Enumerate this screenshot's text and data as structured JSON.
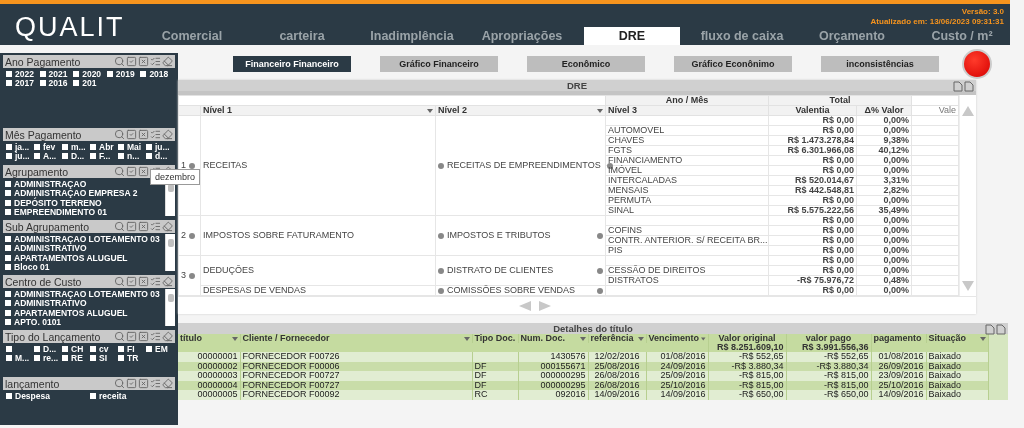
{
  "header": {
    "logo": "QUALIT",
    "version": "Versão: 3.0",
    "updated": "Atualizado em: 13/06/2023 09:31:31",
    "tabs": [
      {
        "label": "Comercial",
        "selected": false
      },
      {
        "label": "carteira",
        "selected": false
      },
      {
        "label": "Inadimplência",
        "selected": false
      },
      {
        "label": "Apropriações",
        "selected": false
      },
      {
        "label": "DRE",
        "selected": true
      },
      {
        "label": "fluxo de caixa",
        "selected": false
      },
      {
        "label": "Orçamento",
        "selected": false
      },
      {
        "label": "Custo / m²",
        "selected": false
      }
    ]
  },
  "filters": [
    {
      "title": "Ano Pagamento",
      "kind": "years",
      "items": [
        {
          "label": "2022",
          "checked": false
        },
        {
          "label": "2021",
          "checked": false
        },
        {
          "label": "2020",
          "checked": false
        },
        {
          "label": "2019",
          "checked": false
        },
        {
          "label": "2018",
          "checked": false
        },
        {
          "label": "2017",
          "checked": false
        },
        {
          "label": "2016",
          "checked": false
        },
        {
          "label": "201",
          "checked": false
        }
      ]
    },
    {
      "title": "Mês Pagamento",
      "kind": "grid",
      "items": [
        {
          "label": "ja...",
          "checked": false
        },
        {
          "label": "fev",
          "checked": false
        },
        {
          "label": "m...",
          "checked": false
        },
        {
          "label": "Abr",
          "checked": false
        },
        {
          "label": "Mai",
          "checked": false
        },
        {
          "label": "ju...",
          "checked": false
        },
        {
          "label": "ju...",
          "checked": false
        },
        {
          "label": "A...",
          "checked": false
        },
        {
          "label": "D...",
          "checked": false
        },
        {
          "label": "F...",
          "checked": false
        },
        {
          "label": "n...",
          "checked": false
        },
        {
          "label": "d...",
          "checked": false
        }
      ]
    },
    {
      "title": "Agrupamento",
      "kind": "list",
      "items": [
        {
          "label": "ADMINISTRAÇAO",
          "checked": false
        },
        {
          "label": "ADMINISTRAÇAO EMPRESA 2",
          "checked": false
        },
        {
          "label": "DEPÓSITO TERRENO",
          "checked": false
        },
        {
          "label": "EMPREENDIMENTO 01",
          "checked": false
        }
      ]
    },
    {
      "title": "Sub Agrupamento",
      "kind": "list",
      "items": [
        {
          "label": "ADMINISTRAÇAO LOTEAMENTO 03",
          "checked": false
        },
        {
          "label": "ADMINISTRATIVO",
          "checked": false
        },
        {
          "label": "APARTAMENTOS ALUGUEL",
          "checked": false
        },
        {
          "label": "Bloco 01",
          "checked": false
        }
      ]
    },
    {
      "title": "Centro de Custo",
      "kind": "list",
      "items": [
        {
          "label": "ADMINISTRAÇAO LOTEAMENTO 03",
          "checked": false
        },
        {
          "label": "ADMINISTRATIVO",
          "checked": false
        },
        {
          "label": "APARTAMENTOS ALUGUEL",
          "checked": false
        },
        {
          "label": "APTO. 0101",
          "checked": false
        }
      ]
    },
    {
      "title": "Tipo do Lançamento",
      "kind": "grid",
      "items": [
        {
          "checked": false
        },
        {
          "label": "D...",
          "checked": false
        },
        {
          "label": "CH",
          "checked": false
        },
        {
          "label": "cv",
          "checked": false
        },
        {
          "label": "FI",
          "checked": false
        },
        {
          "label": "EM",
          "checked": false
        },
        {
          "label": "M...",
          "checked": false
        },
        {
          "label": "re...",
          "checked": false
        },
        {
          "label": "RE",
          "checked": false
        },
        {
          "label": "SI",
          "checked": false
        },
        {
          "label": "TR",
          "checked": false
        }
      ]
    },
    {
      "title": "lançamento",
      "kind": "pair",
      "items": [
        {
          "label": "Despesa",
          "checked": false
        },
        {
          "label": "receita",
          "checked": false
        }
      ]
    }
  ],
  "tooltip": "dezembro",
  "buttons": [
    {
      "label": "Financeiro Financeiro",
      "selected": true
    },
    {
      "label": "Gráfico Financeiro",
      "selected": false
    },
    {
      "label": "Econômico",
      "selected": false
    },
    {
      "label": "Gráfico Econônimo",
      "selected": false
    },
    {
      "label": "inconsistências",
      "selected": false
    }
  ],
  "dre": {
    "title": "DRE",
    "group_header": "Ano / Mês",
    "total_header": "Total",
    "columns": [
      "Nível 1",
      "Nível 2",
      "Nível 3",
      "Valentia",
      "Δ% Valor",
      "Vale"
    ],
    "groups": [
      {
        "number": "1",
        "sections": [
          {
            "level1": "RECEITAS",
            "level2": "RECEITAS DE EMPREENDIMENTOS",
            "rows": [
              {
                "value": "R$ 0,00",
                "pct": "0,00%"
              },
              {
                "level3": "AUTOMOVEL",
                "value": "R$ 0,00",
                "pct": "0,00%"
              },
              {
                "level3": "CHAVES",
                "value": "R$ 1.473.278,84",
                "pct": "9,38%"
              },
              {
                "level3": "FGTS",
                "value": "R$ 6.301.966,08",
                "pct": "40,12%"
              },
              {
                "level3": "FINANCIAMENTO",
                "value": "R$ 0,00",
                "pct": "0,00%"
              },
              {
                "level3": "IMÓVEL",
                "value": "R$ 0,00",
                "pct": "0,00%"
              },
              {
                "level3": "INTERCALADAS",
                "value": "R$ 520.014,67",
                "pct": "3,31%"
              },
              {
                "level3": "MENSAIS",
                "value": "R$ 442.548,81",
                "pct": "2,82%"
              },
              {
                "level3": "PERMUTA",
                "value": "R$ 0,00",
                "pct": "0,00%"
              },
              {
                "level3": "SINAL",
                "value": "R$ 5.575.222,56",
                "pct": "35,49%"
              }
            ]
          }
        ]
      },
      {
        "number": "2",
        "sections": [
          {
            "level1": "IMPOSTOS SOBRE FATURAMENTO",
            "level2": "IMPOSTOS E TRIBUTOS",
            "rows": [
              {
                "value": "R$ 0,00",
                "pct": "0,00%"
              },
              {
                "level3": "COFINS",
                "value": "R$ 0,00",
                "pct": "0,00%"
              },
              {
                "level3": "CONTR. ANTERIOR. S/ RECEITA BR...",
                "value": "R$ 0,00",
                "pct": "0,00%"
              },
              {
                "level3": "PIS",
                "value": "R$ 0,00",
                "pct": "0,00%"
              }
            ]
          }
        ]
      },
      {
        "number": "3",
        "sections": [
          {
            "level1": "DEDUÇÕES",
            "level2": "DISTRATO DE CLIENTES",
            "rows": [
              {
                "value": "R$ 0,00",
                "pct": "0,00%"
              },
              {
                "level3": "CESSÃO DE DIREITOS",
                "value": "R$ 0,00",
                "pct": "0,00%"
              },
              {
                "level3": "DISTRATOS",
                "value": "-R$ 75.976,72",
                "pct": "0,48%"
              }
            ]
          },
          {
            "level1": "DESPESAS DE VENDAS",
            "level2": "COMISSÕES SOBRE VENDAS",
            "rows": [
              {
                "value": "R$ 0,00",
                "pct": "0,00%"
              }
            ]
          }
        ]
      }
    ]
  },
  "details": {
    "title": "Detalhes do título",
    "columns": [
      "título",
      "Cliente / Fornecedor",
      "Tipo Doc.",
      "Num. Doc.",
      "referência",
      "Vencimento",
      "Valor original",
      "valor pago",
      "pagamento",
      "Situação"
    ],
    "totals": {
      "original": "R$ 8.251.609,10",
      "paid": "R$ 3.991.556,36"
    },
    "rows": [
      [
        "00000001",
        "FORNECEDOR F00726",
        "",
        "1430576",
        "12/02/2016",
        "01/08/2016",
        "-R$ 552,65",
        "-R$ 552,65",
        "01/08/2016",
        "Baixado"
      ],
      [
        "00000002",
        "FORNECEDOR F00006",
        "DF",
        "000155671",
        "25/08/2016",
        "24/09/2016",
        "-R$ 3.880,34",
        "-R$ 3.880,34",
        "26/09/2016",
        "Baixado"
      ],
      [
        "00000003",
        "FORNECEDOR F00727",
        "DF",
        "000000295",
        "26/08/2016",
        "25/09/2016",
        "-R$ 815,00",
        "-R$ 815,00",
        "23/09/2016",
        "Baixado"
      ],
      [
        "00000004",
        "FORNECEDOR F00727",
        "DF",
        "000000295",
        "26/08/2016",
        "25/10/2016",
        "-R$ 815,00",
        "-R$ 815,00",
        "25/10/2016",
        "Baixado"
      ],
      [
        "00000005",
        "FORNECEDOR F00092",
        "RC",
        "092016",
        "14/09/2016",
        "14/09/2016",
        "-R$ 650,00",
        "-R$ 650,00",
        "14/09/2016",
        "Baixado"
      ]
    ]
  }
}
